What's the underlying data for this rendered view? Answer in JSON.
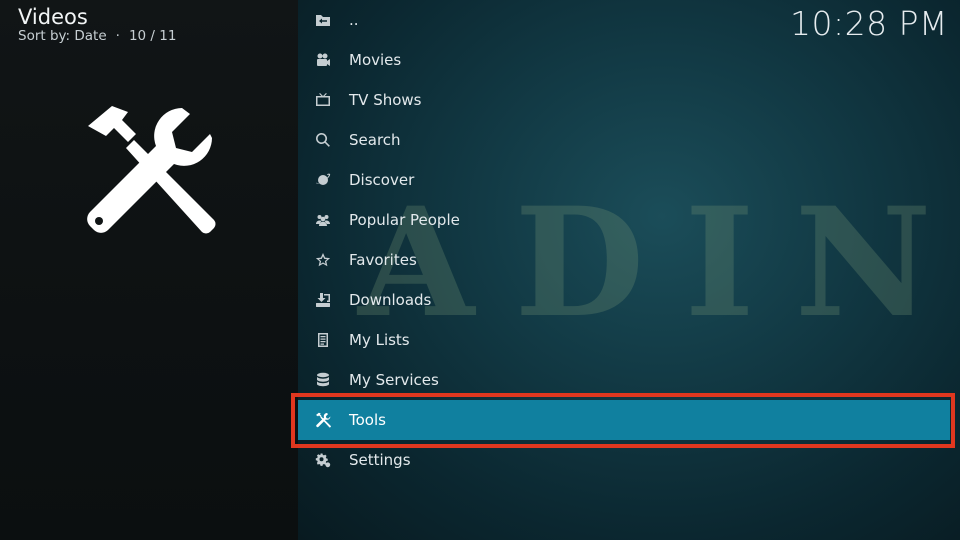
{
  "header": {
    "title": "Videos",
    "sort_label": "Sort by: Date",
    "separator": "·",
    "position": "10 / 11",
    "clock": "10:28 PM"
  },
  "background": {
    "fanart_text": "ADINA"
  },
  "menu": {
    "items": [
      {
        "label": "..",
        "icon": "back-folder-icon"
      },
      {
        "label": "Movies",
        "icon": "film-icon"
      },
      {
        "label": "TV Shows",
        "icon": "tv-icon"
      },
      {
        "label": "Search",
        "icon": "search-icon"
      },
      {
        "label": "Discover",
        "icon": "planet-icon"
      },
      {
        "label": "Popular People",
        "icon": "people-icon"
      },
      {
        "label": "Favorites",
        "icon": "star-icon"
      },
      {
        "label": "Downloads",
        "icon": "download-icon"
      },
      {
        "label": "My Lists",
        "icon": "list-icon"
      },
      {
        "label": "My Services",
        "icon": "database-icon"
      },
      {
        "label": "Tools",
        "icon": "tools-icon"
      },
      {
        "label": "Settings",
        "icon": "gears-icon"
      }
    ],
    "focused_index": 10
  },
  "colors": {
    "focus": "#10809f",
    "highlight_border": "#e0371f"
  }
}
